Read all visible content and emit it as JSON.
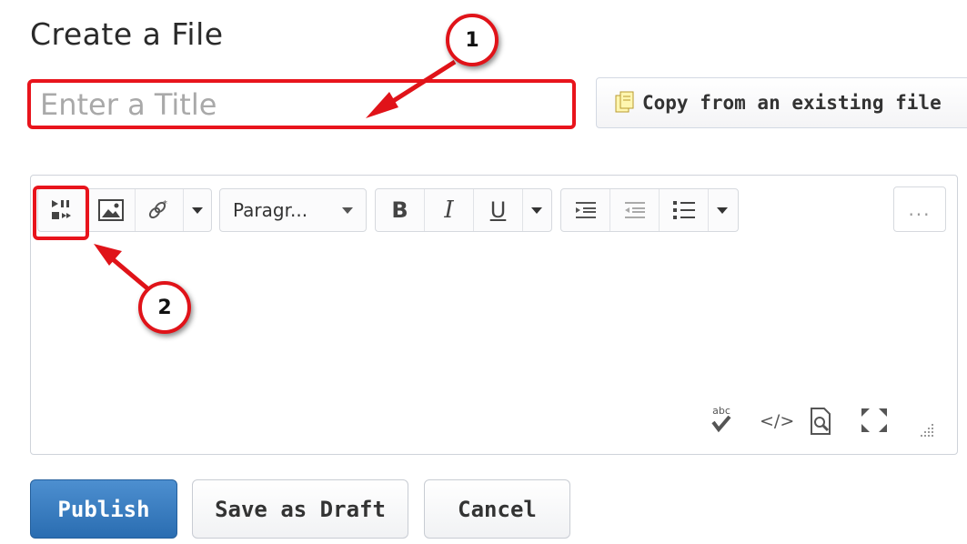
{
  "page": {
    "title": "Create a File"
  },
  "title_input": {
    "placeholder": "Enter a Title",
    "value": ""
  },
  "copy_button": {
    "label": "Copy from an existing file"
  },
  "toolbar": {
    "format_select": "Paragr...",
    "bold": "B",
    "italic": "I",
    "underline": "U",
    "more": "..."
  },
  "status_bar": {
    "spellcheck_label": "abc",
    "source_code_label": "</>"
  },
  "annotations": {
    "marker_1": "1",
    "marker_2": "2"
  },
  "actions": {
    "publish": "Publish",
    "save_draft": "Save as Draft",
    "cancel": "Cancel"
  },
  "colors": {
    "annotation_red": "#e8141c",
    "primary_blue": "#2a6db1"
  }
}
